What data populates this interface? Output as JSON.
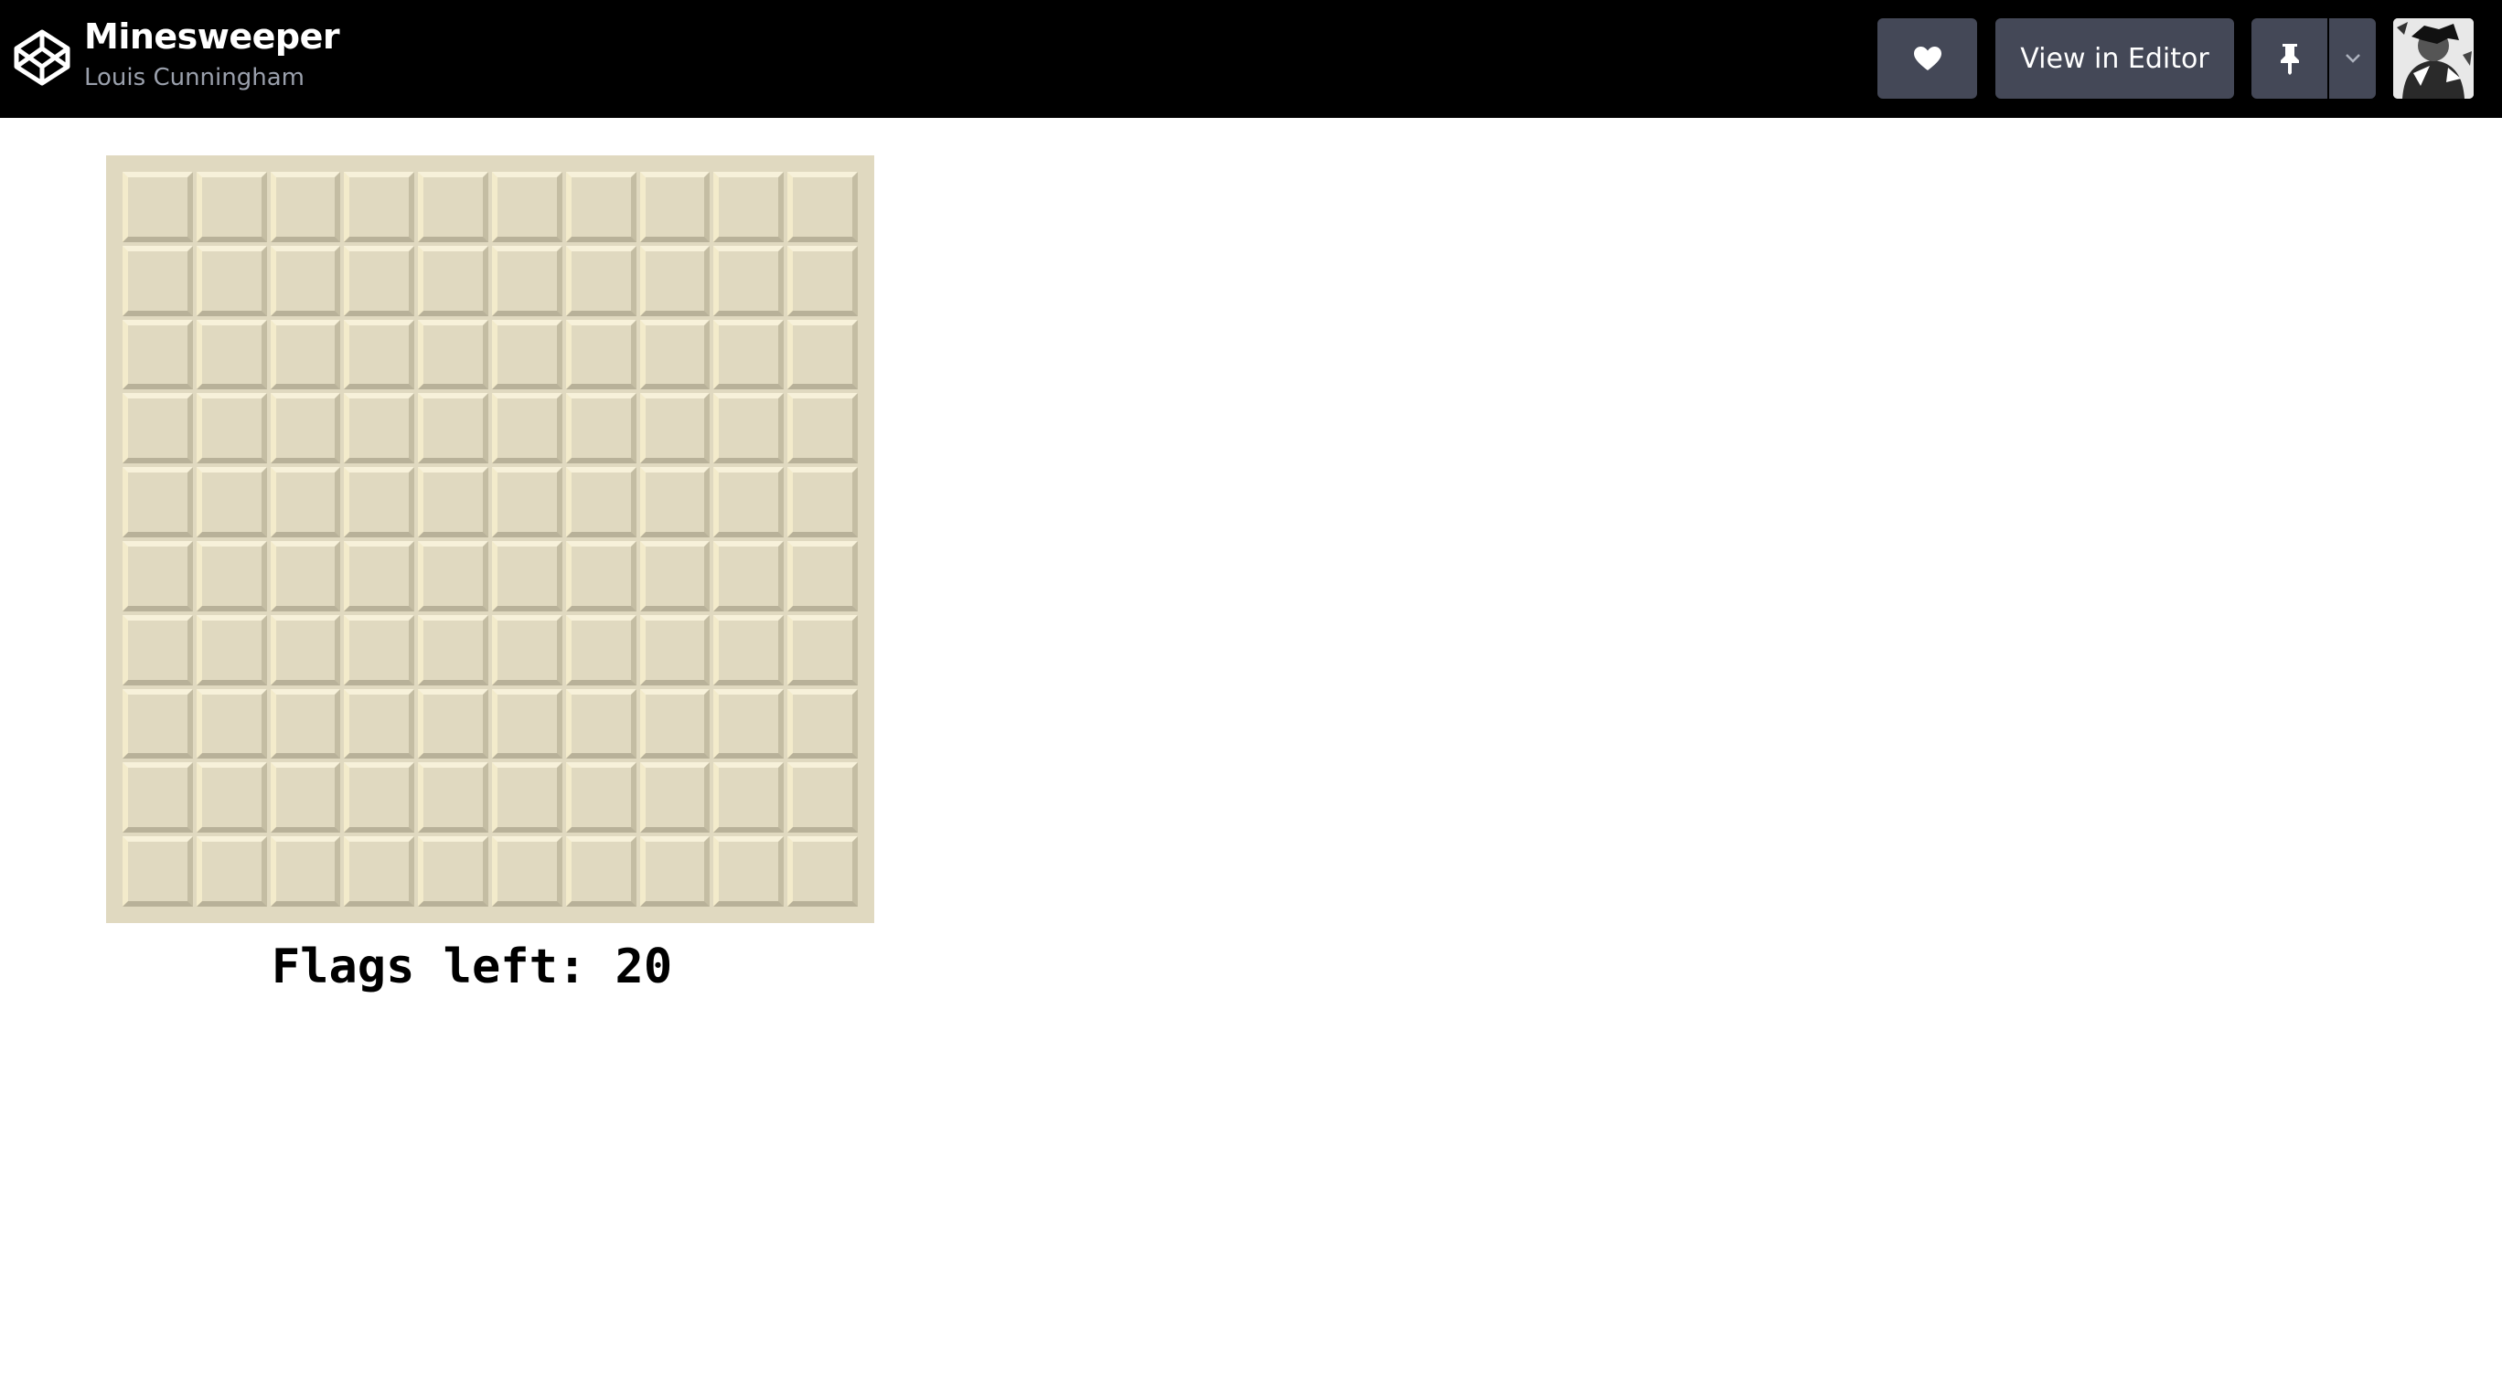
{
  "header": {
    "title": "Minesweeper",
    "author": "Louis Cunningham",
    "heart_icon": "heart-icon",
    "view_in_editor_label": "View in Editor",
    "pin_icon": "pin-icon",
    "caret_icon": "chevron-down-icon",
    "logo_icon": "codepen-logo-icon",
    "avatar_icon": "user-avatar"
  },
  "game": {
    "rows": 10,
    "columns": 10,
    "flags_label": "Flags left: 20"
  },
  "colors": {
    "topbar": "#000000",
    "button": "#444857",
    "tile": "#e0d9c0"
  }
}
